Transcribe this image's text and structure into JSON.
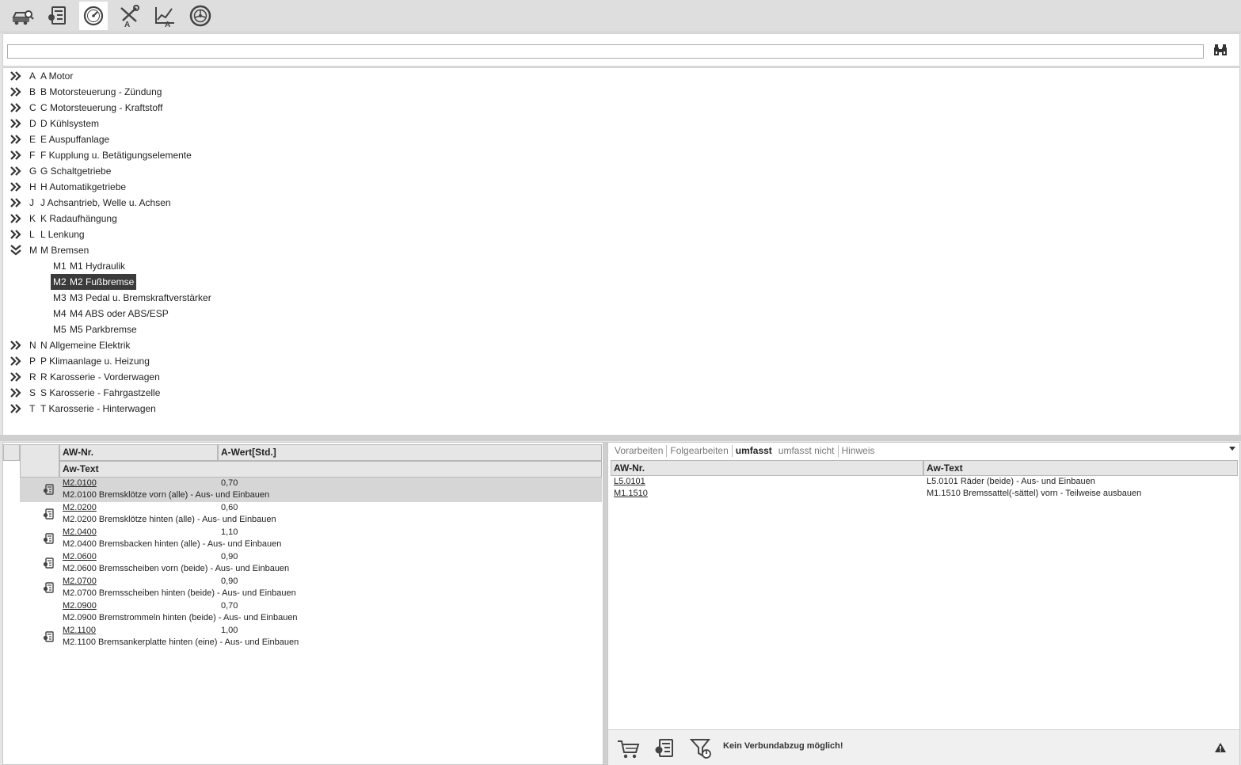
{
  "toolbar": {
    "buttons": [
      {
        "icon": "vehicle-search-icon"
      },
      {
        "icon": "worklist-icon"
      },
      {
        "icon": "speedometer-icon",
        "active": true
      },
      {
        "icon": "tools-icon"
      },
      {
        "icon": "chart-edit-icon"
      },
      {
        "icon": "wheel-icon"
      }
    ]
  },
  "search": {
    "value": "",
    "placeholder": ""
  },
  "tree": {
    "groups": [
      {
        "code": "A",
        "label": "A Motor"
      },
      {
        "code": "B",
        "label": "B Motorsteuerung - Zündung"
      },
      {
        "code": "C",
        "label": "C Motorsteuerung - Kraftstoff"
      },
      {
        "code": "D",
        "label": "D Kühlsystem"
      },
      {
        "code": "E",
        "label": "E Auspuffanlage"
      },
      {
        "code": "F",
        "label": "F Kupplung u. Betätigungselemente"
      },
      {
        "code": "G",
        "label": "G Schaltgetriebe"
      },
      {
        "code": "H",
        "label": "H Automatikgetriebe"
      },
      {
        "code": "J",
        "label": "J Achsantrieb, Welle u. Achsen"
      },
      {
        "code": "K",
        "label": "K Radaufhängung"
      },
      {
        "code": "L",
        "label": "L Lenkung"
      },
      {
        "code": "M",
        "label": "M Bremsen",
        "expanded": true
      },
      {
        "code": "N",
        "label": "N Allgemeine Elektrik"
      },
      {
        "code": "P",
        "label": "P Klimaanlage u. Heizung"
      },
      {
        "code": "R",
        "label": "R Karosserie - Vorderwagen"
      },
      {
        "code": "S",
        "label": "S Karosserie - Fahrgastzelle"
      },
      {
        "code": "T",
        "label": "T Karosserie - Hinterwagen"
      }
    ],
    "children": [
      {
        "code": "M1",
        "label": "M1 Hydraulik"
      },
      {
        "code": "M2",
        "label": "M2 Fußbremse",
        "selected": true
      },
      {
        "code": "M3",
        "label": "M3 Pedal u. Bremskraftverstärker"
      },
      {
        "code": "M4",
        "label": "M4 ABS oder ABS/ESP"
      },
      {
        "code": "M5",
        "label": "M5 Parkbremse"
      }
    ]
  },
  "left_table": {
    "headers": {
      "aw_nr": "AW-Nr.",
      "a_wert": "A-Wert[Std.]",
      "aw_text": "Aw-Text"
    },
    "rows": [
      {
        "nr": "M2.0100",
        "value": "0,70",
        "text": "M2.0100 Bremsklötze vorn (alle) - Aus- und Einbauen",
        "icon": true,
        "selected": true
      },
      {
        "nr": "M2.0200",
        "value": "0,60",
        "text": "M2.0200 Bremsklötze hinten (alle) - Aus- und Einbauen",
        "icon": true
      },
      {
        "nr": "M2.0400",
        "value": "1,10",
        "text": "M2.0400 Bremsbacken hinten (alle) - Aus- und Einbauen",
        "icon": true
      },
      {
        "nr": "M2.0600",
        "value": "0,90",
        "text": "M2.0600 Bremsscheiben vorn (beide) - Aus- und Einbauen",
        "icon": true
      },
      {
        "nr": "M2.0700",
        "value": "0,90",
        "text": "M2.0700 Bremsscheiben hinten (beide) - Aus- und Einbauen",
        "icon": true
      },
      {
        "nr": "M2.0900",
        "value": "0,70",
        "text": "M2.0900 Bremstrommeln hinten (beide) - Aus- und Einbauen",
        "icon": false
      },
      {
        "nr": "M2.1100",
        "value": "1,00",
        "text": "M2.1100 Bremsankerplatte hinten (eine) - Aus- und Einbauen",
        "icon": true
      }
    ]
  },
  "right_panel": {
    "tabs": [
      {
        "label": "Vorarbeiten"
      },
      {
        "label": "Folgearbeiten"
      },
      {
        "label": "umfasst",
        "active": true
      },
      {
        "label": "umfasst nicht"
      },
      {
        "label": "Hinweis"
      }
    ],
    "headers": {
      "aw_nr": "AW-Nr.",
      "aw_text": "Aw-Text"
    },
    "rows": [
      {
        "nr": "L5.0101",
        "text": "L5.0101 Räder (beide) - Aus- und Einbauen"
      },
      {
        "nr": "M1.1510",
        "text": "M1.1510 Bremssattel(-sättel) vorn - Teilweise ausbauen"
      }
    ],
    "status_text": "Kein Verbundabzug möglich!"
  }
}
